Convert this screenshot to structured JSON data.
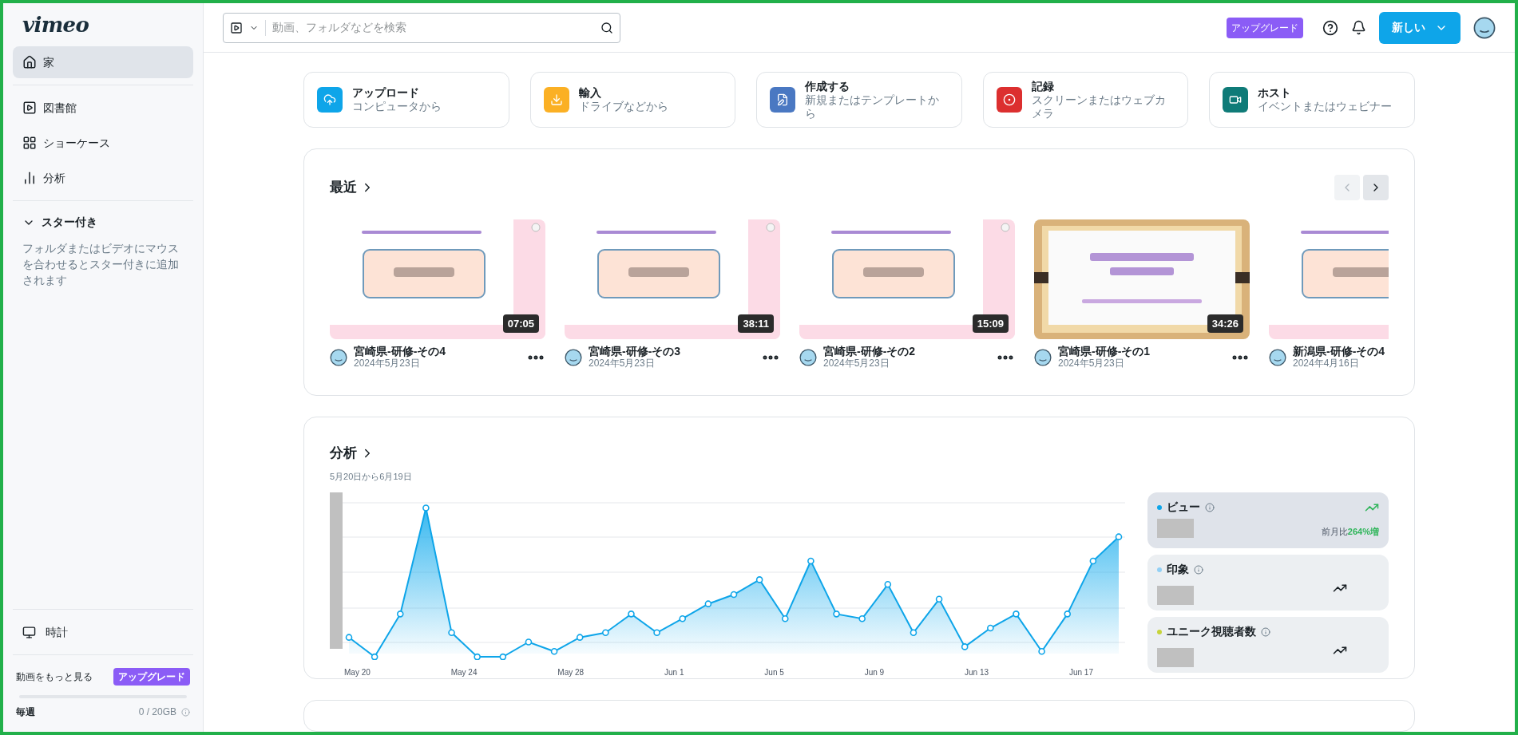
{
  "sidebar": {
    "logo": "vimeo",
    "items": [
      {
        "label": "家",
        "selected": true
      }
    ],
    "library_items": [
      {
        "label": "図書館",
        "selected": false
      },
      {
        "label": "ショーケース",
        "selected": false
      },
      {
        "label": "分析",
        "selected": false
      }
    ],
    "starred": {
      "title": "スター付き",
      "expanded": true,
      "hint": "フォルダまたはビデオにマウスを合わせるとスター付きに追加されます"
    },
    "watch_item": {
      "label": "時計",
      "selected": false
    },
    "upsell": {
      "text": "動画をもっと見る",
      "button": "アップグレード"
    },
    "storage": {
      "period": "毎週",
      "usage": "0 / 20GB",
      "level": 0
    }
  },
  "topbar": {
    "search": {
      "placeholder": "動画、フォルダなどを検索"
    },
    "upgrade": "アップグレード",
    "new_button": "新しい"
  },
  "actions": [
    {
      "title": "アップロード",
      "subtitle": "コンピュータから",
      "color": "#0ea5e9"
    },
    {
      "title": "輸入",
      "subtitle": "ドライブなどから",
      "color": "#fbb024"
    },
    {
      "title": "作成する",
      "subtitle": "新規またはテンプレートから",
      "color": "#4a78c2"
    },
    {
      "title": "記録",
      "subtitle": "スクリーンまたはウェブカメラ",
      "color": "#dc2f2f"
    },
    {
      "title": "ホスト",
      "subtitle": "イベントまたはウェビナー",
      "color": "#0f7b78"
    }
  ],
  "recent": {
    "title": "最近",
    "prev_disabled": true,
    "videos": [
      {
        "title": "宮崎県-研修-その4",
        "date": "2024年5月23日",
        "duration": "07:05",
        "kind": "pink"
      },
      {
        "title": "宮崎県-研修-その3",
        "date": "2024年5月23日",
        "duration": "38:11",
        "kind": "pink"
      },
      {
        "title": "宮崎県-研修-その2",
        "date": "2024年5月23日",
        "duration": "15:09",
        "kind": "pink"
      },
      {
        "title": "宮崎県-研修-その1",
        "date": "2024年5月23日",
        "duration": "34:26",
        "kind": "gold"
      },
      {
        "title": "新潟県-研修-その4",
        "date": "2024年4月16日",
        "kind": "pink"
      }
    ]
  },
  "analytics": {
    "title": "分析",
    "range": "5月20日から6月19日",
    "x_labels": [
      "May 20",
      "May 24",
      "May 28",
      "Jun 1",
      "Jun 5",
      "Jun 9",
      "Jun 13",
      "Jun 17"
    ],
    "metrics": [
      {
        "label": "ビュー",
        "color": "#0ea5e9",
        "selected": true,
        "comparison_prefix": "前月比",
        "comparison_value": "264%増"
      },
      {
        "label": "印象",
        "color": "#93d0f5",
        "selected": false
      },
      {
        "label": "ユニーク視聴者数",
        "color": "#c7d43a",
        "selected": false
      }
    ]
  }
}
